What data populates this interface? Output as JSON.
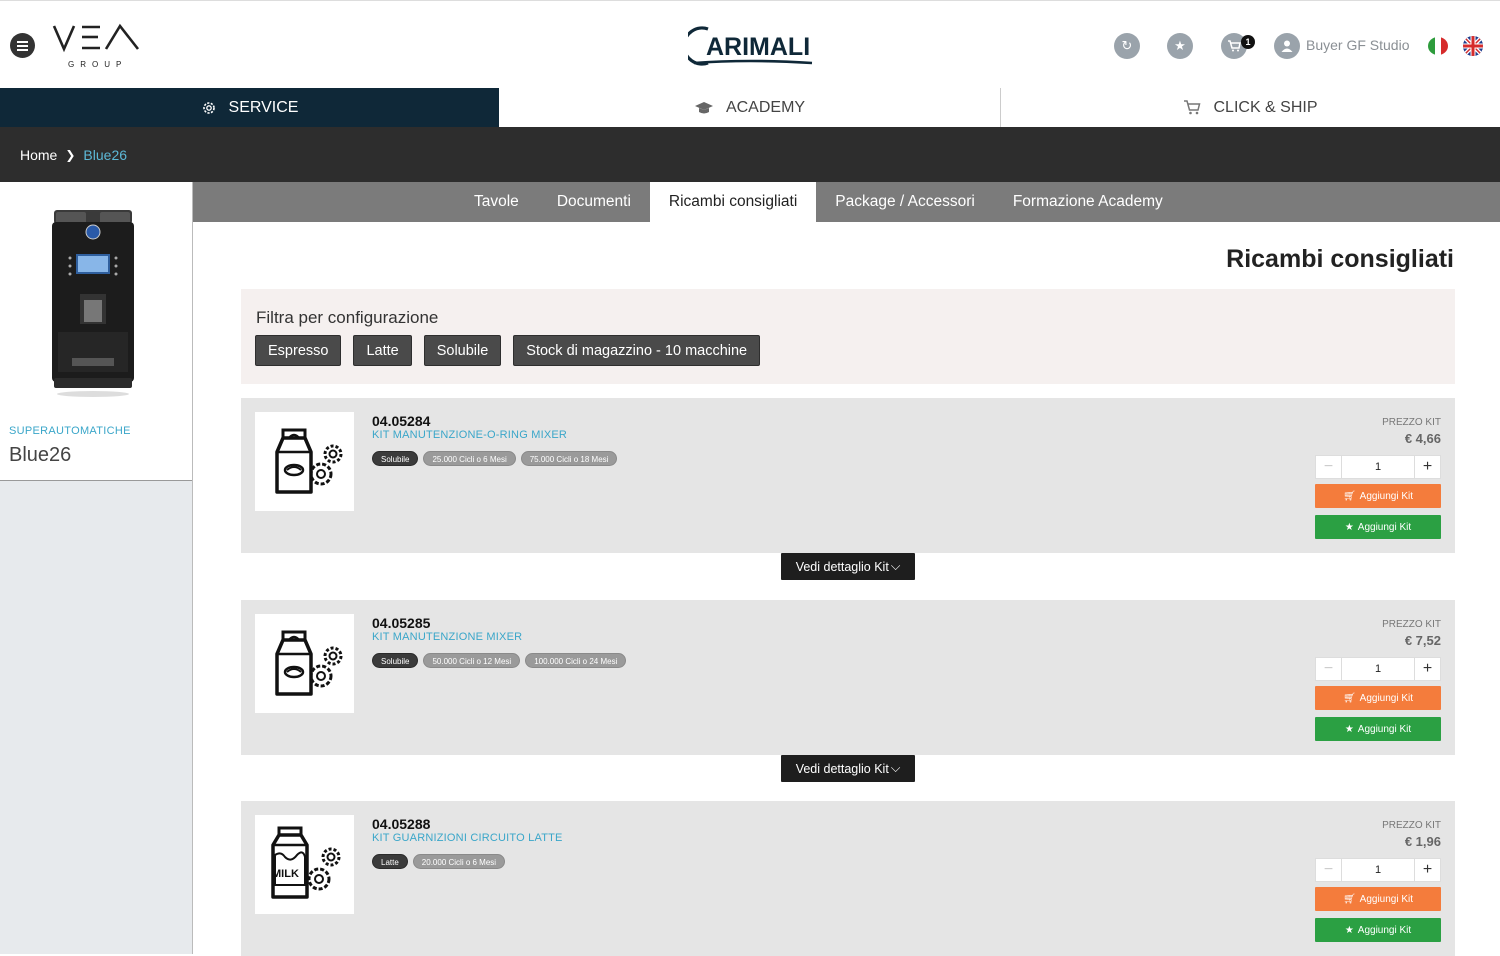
{
  "header": {
    "vea_logo_text": "VEA",
    "vea_logo_sub": "GROUP",
    "brand_logo_text": "CARIMALI",
    "cart_count": "1",
    "user_name": "Buyer GF Studio",
    "icons": [
      "menu-icon",
      "refresh-icon",
      "star-icon",
      "cart-icon",
      "user-icon",
      "flag-it-icon",
      "flag-uk-icon"
    ]
  },
  "main_nav": {
    "tabs": [
      {
        "label": "SERVICE",
        "icon": "gear-icon",
        "active": true
      },
      {
        "label": "ACADEMY",
        "icon": "graduation-cap-icon",
        "active": false
      },
      {
        "label": "CLICK & SHIP",
        "icon": "cart-icon",
        "active": false
      }
    ]
  },
  "breadcrumb": {
    "home": "Home",
    "current": "Blue26"
  },
  "sidebar": {
    "category": "SUPERAUTOMATICHE",
    "model": "Blue26"
  },
  "sub_nav": {
    "tabs": [
      {
        "label": "Tavole",
        "active": false
      },
      {
        "label": "Documenti",
        "active": false
      },
      {
        "label": "Ricambi consigliati",
        "active": true
      },
      {
        "label": "Package / Accessori",
        "active": false
      },
      {
        "label": "Formazione Academy",
        "active": false
      }
    ]
  },
  "content": {
    "title": "Ricambi consigliati",
    "filter_label": "Filtra per configurazione",
    "filters": [
      "Espresso",
      "Latte",
      "Solubile",
      "Stock di magazzino - 10 macchine"
    ]
  },
  "kits": [
    {
      "code": "04.05284",
      "name": "KIT MANUTENZIONE-O-RING MIXER",
      "image": "coffee-bag-gear-icon",
      "tags": [
        "Solubile",
        "25.000 Cicli o 6 Mesi",
        "75.000 Cicli o 18 Mesi"
      ],
      "price_label": "PREZZO KIT",
      "price": "€ 4,66",
      "qty": "1",
      "add_label": "Aggiungi Kit",
      "fav_label": "Aggiungi Kit",
      "detail_label": "Vedi dettaglio Kit"
    },
    {
      "code": "04.05285",
      "name": "KIT MANUTENZIONE MIXER",
      "image": "coffee-bag-gear-icon",
      "tags": [
        "Solubile",
        "50.000 Cicli o 12 Mesi",
        "100.000 Cicli o 24 Mesi"
      ],
      "price_label": "PREZZO KIT",
      "price": "€ 7,52",
      "qty": "1",
      "add_label": "Aggiungi Kit",
      "fav_label": "Aggiungi Kit",
      "detail_label": "Vedi dettaglio Kit"
    },
    {
      "code": "04.05288",
      "name": "KIT GUARNIZIONI CIRCUITO LATTE",
      "image": "milk-carton-gear-icon",
      "milk_text": "MILK",
      "tags": [
        "Latte",
        "20.000 Cicli o 6 Mesi"
      ],
      "price_label": "PREZZO KIT",
      "price": "€ 1,96",
      "qty": "1",
      "add_label": "Aggiungi Kit",
      "fav_label": "Aggiungi Kit"
    }
  ],
  "colors": {
    "navy": "#0f2838",
    "accent_blue": "#3aa6c9",
    "orange": "#f47c3c",
    "green": "#2ba043",
    "dark_bar": "#2d2d2d",
    "grey_tabs": "#7b7b7b"
  }
}
